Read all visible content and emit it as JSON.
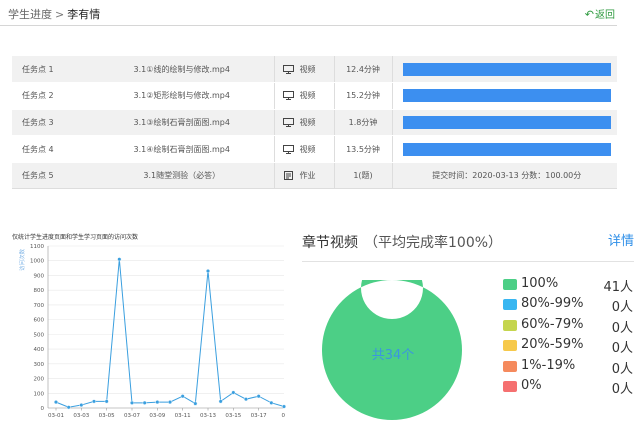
{
  "header": {
    "breadcrumb_root": "学生进度",
    "breadcrumb_sep": ">",
    "student_name": "李有情",
    "back_label": "返回"
  },
  "tasks": [
    {
      "index": "任务点 1",
      "name": "3.1①线的绘制与修改.mp4",
      "type": "视频",
      "icon": "monitor-icon",
      "duration": "12.4分钟",
      "progress": 1.0
    },
    {
      "index": "任务点 2",
      "name": "3.1②矩形绘制与修改.mp4",
      "type": "视频",
      "icon": "monitor-icon",
      "duration": "15.2分钟",
      "progress": 1.0
    },
    {
      "index": "任务点 3",
      "name": "3.1③绘制石膏剖面图.mp4",
      "type": "视频",
      "icon": "monitor-icon",
      "duration": "1.8分钟",
      "progress": 1.0
    },
    {
      "index": "任务点 4",
      "name": "3.1④绘制石膏剖面图.mp4",
      "type": "视频",
      "icon": "monitor-icon",
      "duration": "13.5分钟",
      "progress": 1.0
    },
    {
      "index": "任务点 5",
      "name": "3.1随堂测验（必答）",
      "type": "作业",
      "icon": "document-icon",
      "duration": "1(题)",
      "submit_text": "提交时间：2020-03-13    分数：100.00分"
    }
  ],
  "visits_chart": {
    "title": "仅统计学生进度页面和学生学习页面的访问次数",
    "y_label": "访问次数"
  },
  "summary": {
    "title": "章节视频",
    "average": "（平均完成率100%）",
    "detail_label": "详情",
    "center_label": "共34个",
    "legend": [
      {
        "label": "100%",
        "count": "41人",
        "color": "#4ccf86"
      },
      {
        "label": "80%-99%",
        "count": "0人",
        "color": "#38b6f1"
      },
      {
        "label": "60%-79%",
        "count": "0人",
        "color": "#c5d54e"
      },
      {
        "label": "20%-59%",
        "count": "0人",
        "color": "#f6c94b"
      },
      {
        "label": "1%-19%",
        "count": "0人",
        "color": "#f58a5d"
      },
      {
        "label": "0%",
        "count": "0人",
        "color": "#f57070"
      }
    ]
  },
  "chart_data": [
    {
      "type": "line",
      "title": "仅统计学生进度页面和学生学习页面的访问次数",
      "ylabel": "访问次数",
      "xlabel": "",
      "ylim": [
        0,
        1100
      ],
      "y_ticks": [
        0,
        100,
        200,
        300,
        400,
        500,
        600,
        700,
        800,
        900,
        1000,
        1100
      ],
      "x_ticks": [
        "03-01",
        "03-03",
        "03-05",
        "03-07",
        "03-09",
        "03-11",
        "03-13",
        "03-15",
        "03-17"
      ],
      "x_ticks_partial_last": "0",
      "x": [
        "03-01",
        "03-02",
        "03-03",
        "03-04",
        "03-05",
        "03-06",
        "03-07",
        "03-08",
        "03-09",
        "03-10",
        "03-11",
        "03-12",
        "03-13",
        "03-14",
        "03-15",
        "03-16",
        "03-17",
        "03-18",
        "03-19"
      ],
      "values": [
        40,
        5,
        20,
        45,
        45,
        1010,
        35,
        35,
        40,
        40,
        80,
        30,
        930,
        45,
        105,
        60,
        80,
        35,
        10
      ],
      "color": "#3a9fdf",
      "grid": true
    },
    {
      "type": "pie",
      "title": "章节视频",
      "categories": [
        "100%",
        "80%-99%",
        "60%-79%",
        "20%-59%",
        "1%-19%",
        "0%"
      ],
      "values": [
        41,
        0,
        0,
        0,
        0,
        0
      ],
      "colors": [
        "#4ccf86",
        "#38b6f1",
        "#c5d54e",
        "#f6c94b",
        "#f58a5d",
        "#f57070"
      ]
    }
  ]
}
